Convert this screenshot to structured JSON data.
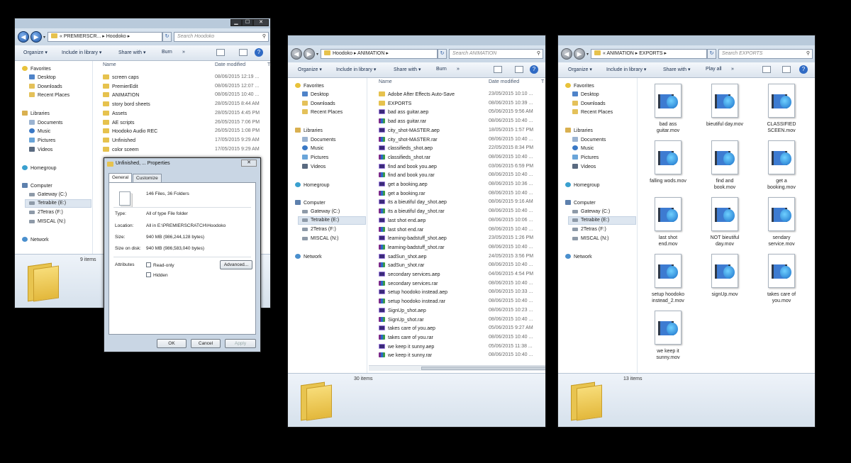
{
  "win1": {
    "address": "« PREMIERSCR... ▸ Hoodoko ▸",
    "search_placeholder": "Search Hoodoko",
    "toolbar": [
      "Organize ▾",
      "Include in library ▾",
      "Share with ▾",
      "Burn",
      "»"
    ],
    "col_name": "Name",
    "col_date": "Date modified",
    "col_t": "T",
    "rows": [
      {
        "name": "screen caps",
        "date": "08/06/2015 12:19 ..."
      },
      {
        "name": "PremierEdit",
        "date": "08/06/2015 12:07 ..."
      },
      {
        "name": "ANIMATION",
        "date": "08/06/2015 10:40 ..."
      },
      {
        "name": "story bord sheets",
        "date": "28/05/2015 8:44 AM"
      },
      {
        "name": "Assets",
        "date": "28/05/2015 4:45 PM"
      },
      {
        "name": "AE scripts",
        "date": "26/05/2015 7:06 PM"
      },
      {
        "name": "Hoodoko Audio REC",
        "date": "26/05/2015 1:08 PM"
      },
      {
        "name": "Unfinished",
        "date": "17/05/2015 9:29 AM"
      },
      {
        "name": "color sceem",
        "date": "17/05/2015 9:29 AM"
      }
    ],
    "count": "9 items"
  },
  "nav": {
    "favorites": "Favorites",
    "desktop": "Desktop",
    "downloads": "Downloads",
    "recent": "Recent Places",
    "libraries": "Libraries",
    "documents": "Documents",
    "music": "Music",
    "pictures": "Pictures",
    "videos": "Videos",
    "homegroup": "Homegroup",
    "computer": "Computer",
    "gateway": "Gateway (C:)",
    "tetrabite": "Tetrabite (E:)",
    "tetras": "2Tetras (F:)",
    "miscal": "MISCAL (N:)",
    "network": "Network"
  },
  "dialog": {
    "title": "Unfinished, ... Properties",
    "close": "✕",
    "tab_general": "General",
    "tab_customize": "Customize",
    "summary": "146 Files, 36 Folders",
    "type_label": "Type:",
    "type_value": "All of type File folder",
    "location_label": "Location:",
    "location_value": "All in E:\\PREMIERSCRATCH\\Hoodoko",
    "size_label": "Size:",
    "size_value": "940 MB (986,244,128 bytes)",
    "disk_label": "Size on disk:",
    "disk_value": "940 MB (986,583,040 bytes)",
    "attributes_label": "Attributes",
    "readonly": "Read-only",
    "hidden": "Hidden",
    "advanced": "Advanced...",
    "ok": "OK",
    "cancel": "Cancel",
    "apply": "Apply"
  },
  "win2": {
    "address": "Hoodoko ▸ ANIMATION ▸",
    "search_placeholder": "Search ANIMATION",
    "toolbar": [
      "Organize ▾",
      "Include in library ▾",
      "Share with ▾",
      "Burn",
      "»"
    ],
    "col_name": "Name",
    "col_date": "Date modified",
    "col_t": "T",
    "rows": [
      {
        "name": "Adobe After Effects Auto-Save",
        "date": "23/05/2015 10:10 ...",
        "kind": "folder"
      },
      {
        "name": "EXPORTS",
        "date": "08/06/2015 10:39 ...",
        "kind": "folder"
      },
      {
        "name": "bad ass guitar.aep",
        "date": "05/06/2015 9:56 AM",
        "kind": "aep"
      },
      {
        "name": "bad ass guitar.rar",
        "date": "08/06/2015 10:40 ...",
        "kind": "rar"
      },
      {
        "name": "city_shot-MASTER.aep",
        "date": "18/05/2015 1:57 PM",
        "kind": "aep"
      },
      {
        "name": "city_shot-MASTER.rar",
        "date": "08/06/2015 10:40 ...",
        "kind": "rar"
      },
      {
        "name": "classifieds_shot.aep",
        "date": "22/05/2015 8:34 PM",
        "kind": "aep"
      },
      {
        "name": "classifieds_shot.rar",
        "date": "08/06/2015 10:40 ...",
        "kind": "rar"
      },
      {
        "name": "find and book you.aep",
        "date": "03/06/2015 6:59 PM",
        "kind": "aep"
      },
      {
        "name": "find and book you.rar",
        "date": "08/06/2015 10:40 ...",
        "kind": "rar"
      },
      {
        "name": "get a booking.aep",
        "date": "08/06/2015 10:36 ...",
        "kind": "aep"
      },
      {
        "name": "get a booking.rar",
        "date": "08/06/2015 10:40 ...",
        "kind": "rar"
      },
      {
        "name": "its a bieutiful day_shot.aep",
        "date": "08/06/2015 9:16 AM",
        "kind": "aep"
      },
      {
        "name": "its a bieutiful day_shot.rar",
        "date": "08/06/2015 10:40 ...",
        "kind": "rar"
      },
      {
        "name": "last shot end.aep",
        "date": "08/06/2015 10:06 ...",
        "kind": "aep"
      },
      {
        "name": "last shot end.rar",
        "date": "08/06/2015 10:40 ...",
        "kind": "rar"
      },
      {
        "name": "learning-badstuff_shot.aep",
        "date": "23/05/2015 1:26 PM",
        "kind": "aep"
      },
      {
        "name": "learning-badstuff_shot.rar",
        "date": "08/06/2015 10:40 ...",
        "kind": "rar"
      },
      {
        "name": "sadSun_shot.aep",
        "date": "24/05/2015 3:56 PM",
        "kind": "aep"
      },
      {
        "name": "sadSun_shot.rar",
        "date": "08/06/2015 10:40 ...",
        "kind": "rar"
      },
      {
        "name": "secondary services.aep",
        "date": "04/06/2015 4:54 PM",
        "kind": "aep"
      },
      {
        "name": "secondary services.rar",
        "date": "08/06/2015 10:40 ...",
        "kind": "rar"
      },
      {
        "name": "setup hoodoko instead.aep",
        "date": "08/06/2015 10:33 ...",
        "kind": "aep"
      },
      {
        "name": "setup hoodoko instead.rar",
        "date": "08/06/2015 10:40 ...",
        "kind": "rar"
      },
      {
        "name": "SignUp_shot.aep",
        "date": "08/06/2015 10:23 ...",
        "kind": "aep"
      },
      {
        "name": "SignUp_shot.rar",
        "date": "08/06/2015 10:40 ...",
        "kind": "rar"
      },
      {
        "name": "takes care of you.aep",
        "date": "05/06/2015 9:27 AM",
        "kind": "aep"
      },
      {
        "name": "takes care of you.rar",
        "date": "08/06/2015 10:40 ...",
        "kind": "rar"
      },
      {
        "name": "we keep it sunny.aep",
        "date": "05/06/2015 11:38 ...",
        "kind": "aep"
      },
      {
        "name": "we keep it sunny.rar",
        "date": "08/06/2015 10:40 ...",
        "kind": "rar"
      }
    ],
    "count": "30 items"
  },
  "win3": {
    "address": "« ANIMATION ▸ EXPORTS ▸",
    "search_placeholder": "Search EXPORTS",
    "toolbar": [
      "Organize ▾",
      "Include in library ▾",
      "Share with ▾",
      "Play all",
      "»"
    ],
    "tiles": [
      {
        "l1": "bad ass",
        "l2": "guitar.mov"
      },
      {
        "l1": "bieutiful day.mov",
        "l2": ""
      },
      {
        "l1": "CLASSIFIED",
        "l2": "SCEEN.mov"
      },
      {
        "l1": "falling wods.mov",
        "l2": ""
      },
      {
        "l1": "find and",
        "l2": "book.mov"
      },
      {
        "l1": "get a",
        "l2": "booking.mov"
      },
      {
        "l1": "last shot",
        "l2": "end.mov"
      },
      {
        "l1": "NOT bieutiful",
        "l2": "day.mov"
      },
      {
        "l1": "sendary",
        "l2": "service.mov"
      },
      {
        "l1": "setup hoodoko",
        "l2": "instead_2.mov"
      },
      {
        "l1": "signUp.mov",
        "l2": ""
      },
      {
        "l1": "takes care of",
        "l2": "you.mov"
      },
      {
        "l1": "we keep it",
        "l2": "sunny.mov"
      }
    ],
    "count": "13 items"
  },
  "winbtns": {
    "min": "▁",
    "max": "☐",
    "close": "✕"
  },
  "colors": {
    "chrome": "#c6d4e2",
    "selection": "#dde6f0",
    "folder": "#e6c24e"
  }
}
